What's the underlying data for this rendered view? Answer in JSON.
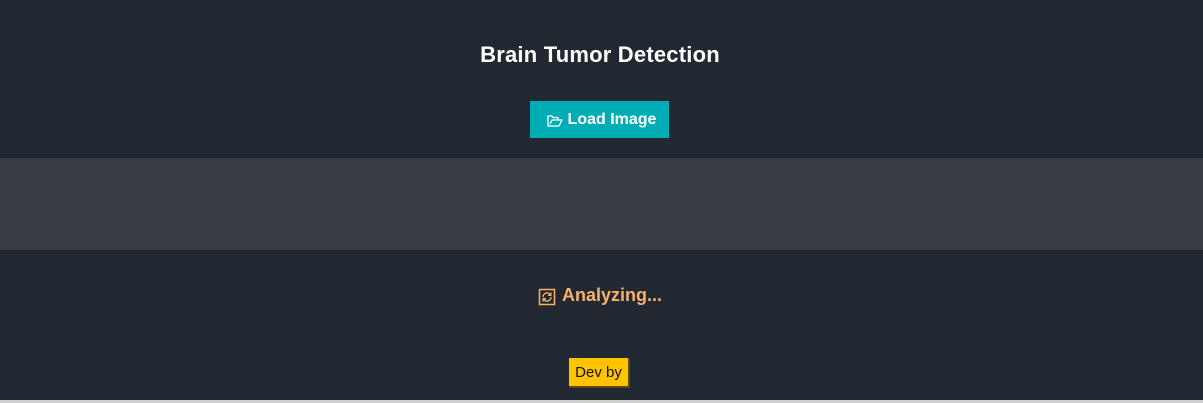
{
  "app": {
    "title": "Brain Tumor Detection"
  },
  "toolbar": {
    "load_label": "Load Image",
    "load_icon": "open-folder-icon"
  },
  "status": {
    "text": "Analyzing...",
    "icon": "refresh-icon",
    "color": "#f6b26b"
  },
  "footer": {
    "dev_label": "Dev by"
  },
  "colors": {
    "background": "#222831",
    "panel": "#393e46",
    "accent": "#00adb5",
    "badge": "#ffc300"
  }
}
